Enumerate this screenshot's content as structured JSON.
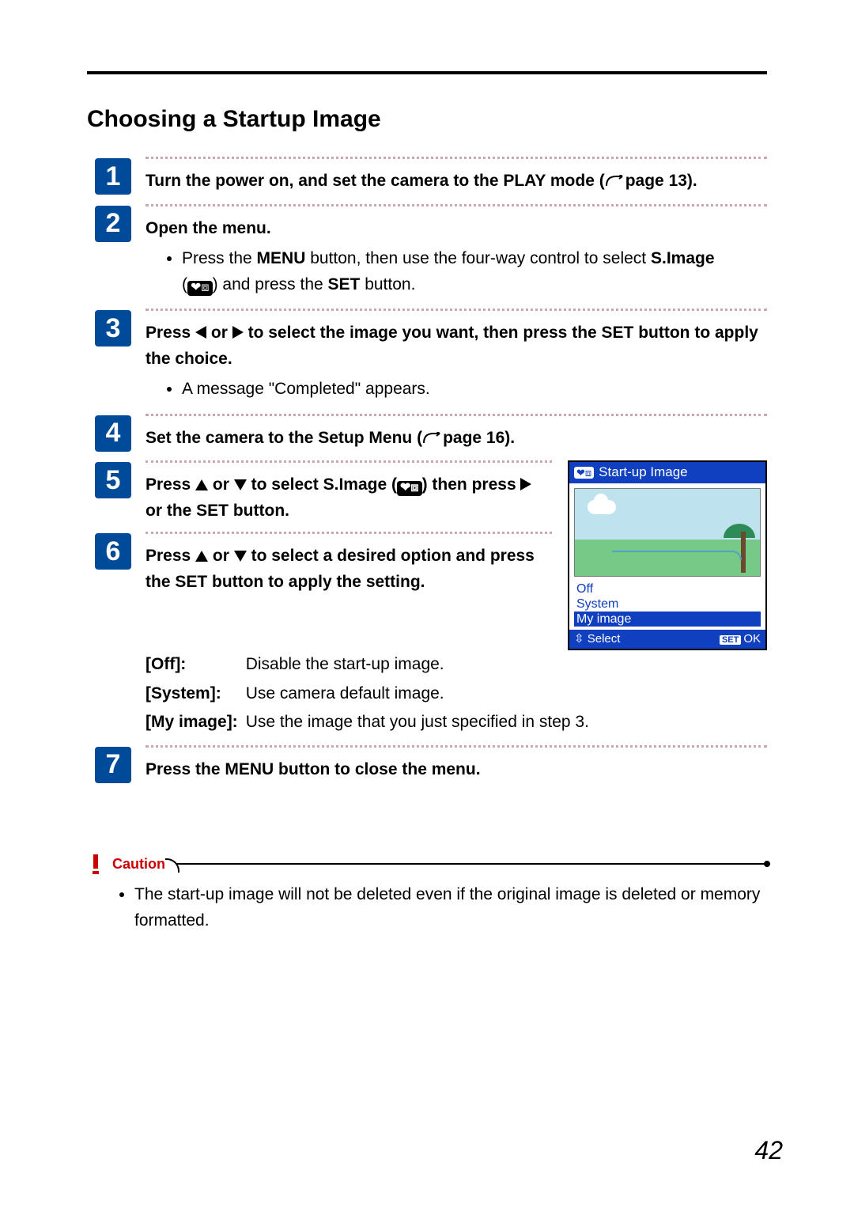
{
  "title": "Choosing a Startup Image",
  "page_number": "42",
  "steps": {
    "s1": {
      "num": "1",
      "text_a": "Turn the power on, and set the camera to the PLAY mode (",
      "text_b": "page 13)."
    },
    "s2": {
      "num": "2",
      "heading": "Open the menu.",
      "bullet_a": "Press the ",
      "bullet_menu": "MENU",
      "bullet_b": " button, then use the four-way control to select ",
      "bullet_simage": "S.Image",
      "bullet_c": " (",
      "bullet_d": ") and press the ",
      "bullet_set": "SET",
      "bullet_e": " button."
    },
    "s3": {
      "num": "3",
      "line1_a": "Press ",
      "line1_b": " or ",
      "line1_c": " to select the image you want, then press the SET button to apply the choice.",
      "bullet": "A message \"Completed\" appears."
    },
    "s4": {
      "num": "4",
      "text_a": "Set the camera to the Setup Menu (",
      "text_b": "page 16)."
    },
    "s5": {
      "num": "5",
      "text_a": "Press ",
      "text_b": " or ",
      "text_c": " to select S.Image (",
      "text_d": ") then press ",
      "text_e": " or the SET button."
    },
    "s6": {
      "num": "6",
      "line_a": "Press ",
      "line_b": " or ",
      "line_c": " to select a desired option and press the SET button to apply the setting.",
      "opts": {
        "off_k": "[Off]:",
        "off_v": "Disable the start-up image.",
        "sys_k": "[System]:",
        "sys_v": "Use camera default image.",
        "my_k": "[My image]:",
        "my_v": "Use the image that you just specified in step 3."
      }
    },
    "s7": {
      "num": "7",
      "text": "Press the MENU button to close the menu."
    }
  },
  "lcd": {
    "title": "Start-up Image",
    "opt_off": "Off",
    "opt_system": "System",
    "opt_my": "My image",
    "foot_select": "Select",
    "foot_set": "SET",
    "foot_ok": "OK"
  },
  "caution": {
    "label": "Caution",
    "text": "The start-up image will not be deleted even if the original image is deleted or memory formatted."
  }
}
